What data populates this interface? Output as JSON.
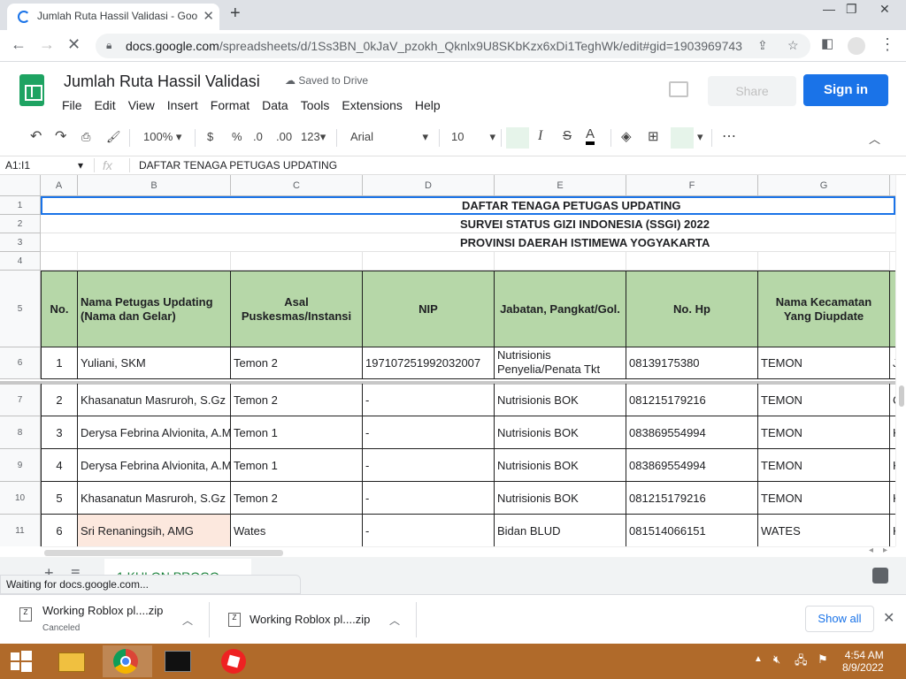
{
  "browser": {
    "tab_title": "Jumlah Ruta Hassil Validasi - Goo",
    "tab_close": "✕",
    "new_tab": "+",
    "url_host": "docs.google.com",
    "url_path": "/spreadsheets/d/1Ss3BN_0kJaV_pzokh_Qknlx9U8SKbKzx6xDi1TeghWk/edit#gid=1903969743"
  },
  "docs": {
    "title": "Jumlah Ruta Hassil Validasi",
    "saved_status": "Saved to Drive",
    "menu": [
      "File",
      "Edit",
      "View",
      "Insert",
      "Format",
      "Data",
      "Tools",
      "Extensions",
      "Help"
    ],
    "share_label": "Share",
    "signin_label": "Sign in"
  },
  "toolbar": {
    "zoom": "100%",
    "currency": "$",
    "percent": "%",
    "dec_less": ".0",
    "dec_more": ".00",
    "format_more": "123",
    "font": "Arial",
    "font_size": "10",
    "italic": "I",
    "strike": "S",
    "text_color": "A",
    "more": "⋯"
  },
  "formula_bar": {
    "name_box": "A1:I1",
    "fx": "fx",
    "content": "DAFTAR TENAGA PETUGAS UPDATING"
  },
  "grid": {
    "columns": [
      "A",
      "B",
      "C",
      "D",
      "E",
      "F",
      "G"
    ],
    "row_numbers": [
      "1",
      "2",
      "3",
      "4",
      "5",
      "6",
      "7",
      "8",
      "9",
      "10",
      "11"
    ],
    "titles": [
      "DAFTAR TENAGA PETUGAS UPDATING",
      "SURVEI STATUS GIZI INDONESIA (SSGI) 2022",
      "PROVINSI DAERAH ISTIMEWA YOGYAKARTA"
    ],
    "headers": [
      "No.",
      "Nama Petugas Updating (Nama dan Gelar)",
      "Asal Puskesmas/Instansi",
      "NIP",
      "Jabatan, Pangkat/Gol.",
      "No. Hp",
      "Nama Kecamatan Yang Diupdate"
    ],
    "rows": [
      [
        "1",
        "Yuliani, SKM",
        "Temon 2",
        "197107251992032007",
        "Nutrisionis Penyelia/Penata Tkt",
        "08139175380",
        "TEMON",
        "J"
      ],
      [
        "2",
        "Khasanatun Masruroh, S.Gz",
        "Temon 2",
        "-",
        "Nutrisionis BOK",
        "081215179216",
        "TEMON",
        "C"
      ],
      [
        "3",
        "Derysa Febrina Alvionita, A.M",
        "Temon 1",
        "-",
        "Nutrisionis BOK",
        "083869554994",
        "TEMON",
        "K"
      ],
      [
        "4",
        "Derysa Febrina Alvionita, A.M",
        "Temon 1",
        "-",
        "Nutrisionis BOK",
        "083869554994",
        "TEMON",
        "K"
      ],
      [
        "5",
        "Khasanatun Masruroh, S.Gz",
        "Temon 2",
        "-",
        "Nutrisionis BOK",
        "081215179216",
        "TEMON",
        "K"
      ],
      [
        "6",
        "Sri Renaningsih, AMG",
        "Wates",
        "-",
        "Bidan BLUD",
        "081514066151",
        "WATES",
        "K"
      ]
    ]
  },
  "sheets": {
    "add": "+",
    "list": "≡",
    "active_tab": "1 KULON PROGO",
    "status_text": "Waiting for docs.google.com..."
  },
  "downloads": {
    "items": [
      {
        "name": "Working Roblox pl....zip",
        "status": "Canceled"
      },
      {
        "name": "Working Roblox pl....zip",
        "status": ""
      }
    ],
    "show_all": "Show all"
  },
  "taskbar": {
    "time": "4:54 AM",
    "date": "8/9/2022"
  },
  "colors": {
    "header_fill": "#b6d7a8",
    "selected_fill": "#fce8de",
    "accent": "#1a73e8",
    "sheets_green": "#1ea362"
  }
}
